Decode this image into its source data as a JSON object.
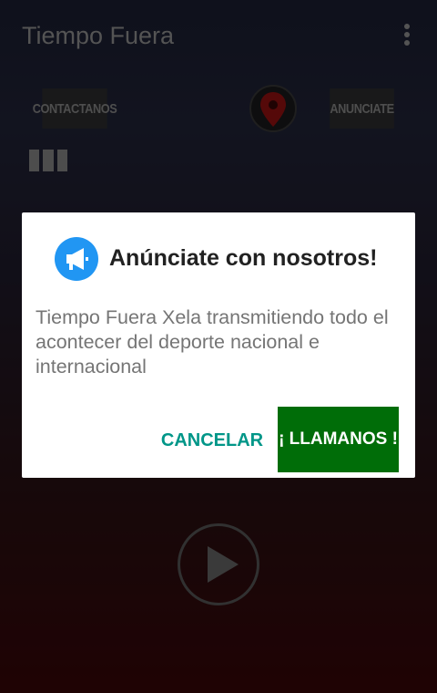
{
  "app": {
    "title": "Tiempo Fuera",
    "contact_label": "CONTACTANOS",
    "advertise_label": "ANUNCIATE"
  },
  "icons": {
    "overflow": "more-vertical-icon",
    "location": "map-pin-icon",
    "equalizer": "bars-icon",
    "play": "play-icon",
    "megaphone": "megaphone-icon"
  },
  "dialog": {
    "title": "Anúnciate con nosotros!",
    "message": "Tiempo Fuera Xela transmitiendo todo el acontecer del deporte nacional e internacional",
    "cancel_label": "CANCELAR",
    "call_label": "¡ LLAMANOS !"
  },
  "colors": {
    "accent": "#009688",
    "call_button": "#006d08",
    "dialog_icon": "#2196f3",
    "pin": "#9b1111"
  }
}
